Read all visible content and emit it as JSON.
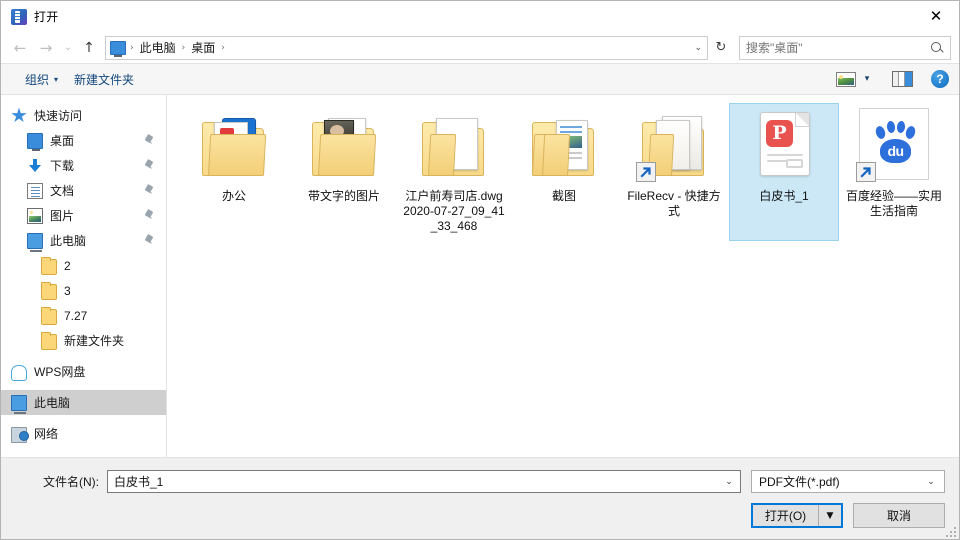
{
  "window": {
    "title": "打开",
    "app_icon": "wps-app-icon",
    "close_label": "✕"
  },
  "nav": {
    "back_label": "←",
    "forward_label": "→",
    "history_label": "⌄",
    "up_label": "↑",
    "breadcrumb": {
      "root_icon": "this-pc-icon",
      "items": [
        "此电脑",
        "桌面"
      ],
      "separator": "›",
      "caret": "⌄"
    },
    "refresh_label": "↻",
    "search": {
      "placeholder": "搜索\"桌面\"",
      "value": "",
      "icon": "search-icon"
    }
  },
  "toolbar": {
    "organize_label": "组织",
    "organize_caret": "▾",
    "new_folder_label": "新建文件夹",
    "view_icon": "view-mode-icon",
    "view_caret": "▾",
    "preview_pane_icon": "preview-pane-icon",
    "help_label": "?"
  },
  "sidebar": {
    "items": [
      {
        "label": "快速访问",
        "icon": "star-icon",
        "level": 0,
        "pinned": false,
        "selected": false
      },
      {
        "label": "桌面",
        "icon": "desktop-icon",
        "level": 1,
        "pinned": true,
        "selected": false
      },
      {
        "label": "下载",
        "icon": "download-icon",
        "level": 1,
        "pinned": true,
        "selected": false
      },
      {
        "label": "文档",
        "icon": "document-icon",
        "level": 1,
        "pinned": true,
        "selected": false
      },
      {
        "label": "图片",
        "icon": "pictures-icon",
        "level": 1,
        "pinned": true,
        "selected": false
      },
      {
        "label": "此电脑",
        "icon": "this-pc-icon",
        "level": 1,
        "pinned": true,
        "selected": false
      },
      {
        "label": "2",
        "icon": "folder-icon",
        "level": 2,
        "pinned": false,
        "selected": false
      },
      {
        "label": "3",
        "icon": "folder-icon",
        "level": 2,
        "pinned": false,
        "selected": false
      },
      {
        "label": "7.27",
        "icon": "folder-icon",
        "level": 2,
        "pinned": false,
        "selected": false
      },
      {
        "label": "新建文件夹",
        "icon": "folder-icon",
        "level": 2,
        "pinned": false,
        "selected": false
      },
      {
        "label": "WPS网盘",
        "icon": "cloud-icon",
        "level": 0,
        "pinned": false,
        "selected": false
      },
      {
        "label": "此电脑",
        "icon": "this-pc-icon",
        "level": 0,
        "pinned": false,
        "selected": true
      },
      {
        "label": "网络",
        "icon": "network-icon",
        "level": 0,
        "pinned": false,
        "selected": false
      }
    ]
  },
  "files": {
    "items": [
      {
        "name": "办公",
        "type": "folder-with-docs",
        "selected": false,
        "shortcut": false
      },
      {
        "name": "带文字的图片",
        "type": "folder-with-photo",
        "selected": false,
        "shortcut": false
      },
      {
        "name": "江户前寿司店.dwg2020-07-27_09_41_33_468",
        "type": "folder-empty",
        "selected": false,
        "shortcut": false
      },
      {
        "name": "截图",
        "type": "folder-with-screens",
        "selected": false,
        "shortcut": false
      },
      {
        "name": "FileRecv - 快捷方式",
        "type": "folder-plain",
        "selected": false,
        "shortcut": true
      },
      {
        "name": "白皮书_1",
        "type": "pdf",
        "selected": true,
        "shortcut": false
      },
      {
        "name": "百度经验——实用生活指南",
        "type": "baidu-link",
        "selected": false,
        "shortcut": true
      }
    ],
    "pdf_badge_letter": "P",
    "baidu_text": "du"
  },
  "footer": {
    "filename_label": "文件名(N):",
    "filename_value": "白皮书_1",
    "filename_caret": "⌄",
    "filetype_value": "PDF文件(*.pdf)",
    "filetype_caret": "⌄",
    "open_label": "打开(O)",
    "open_caret": "▼",
    "cancel_label": "取消"
  },
  "colors": {
    "accent": "#0078d7",
    "selection_bg": "#cce8f6",
    "selection_border": "#99d1ee",
    "toolbar_link": "#13477d",
    "pdf_red": "#e8534f",
    "baidu_blue": "#2d6fdb"
  }
}
